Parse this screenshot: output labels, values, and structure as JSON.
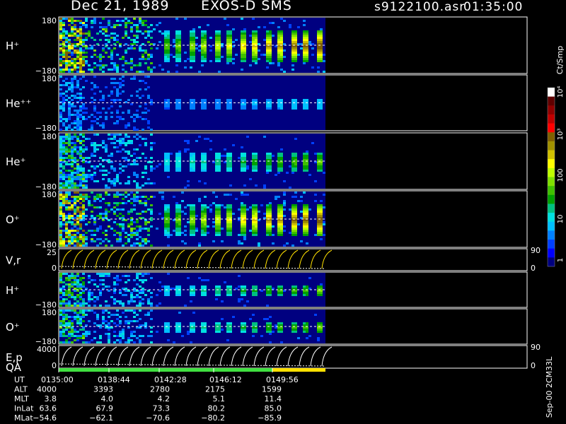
{
  "header": {
    "date": "Dec 21, 1989",
    "instrument": "EXOS-D SMS",
    "file": "s9122100.asr",
    "time": "01:35:00"
  },
  "colorbar": {
    "unit_label": "Ct/Smp",
    "tick_labels": [
      "1",
      "10",
      "100",
      "10³",
      "10⁴"
    ],
    "colors": [
      "#000080",
      "#0000ff",
      "#0040ff",
      "#0080ff",
      "#00c0ff",
      "#00e0e0",
      "#00c080",
      "#00a000",
      "#40c000",
      "#80e000",
      "#c0ff00",
      "#ffff00",
      "#d0c000",
      "#a09000",
      "#806000",
      "#ff0000",
      "#c00000",
      "#900000",
      "#600000",
      "#ffffff"
    ]
  },
  "side_note": "Sep-00 2CM33L",
  "panels": [
    {
      "label": "H⁺",
      "top": "180",
      "bottom": "−180",
      "kind": "spectrogram",
      "intensity": "strong"
    },
    {
      "label": "He⁺⁺",
      "top": "180",
      "bottom": "−180",
      "kind": "spectrogram",
      "intensity": "weak"
    },
    {
      "label": "He⁺",
      "top": "180",
      "bottom": "−180",
      "kind": "spectrogram",
      "intensity": "medium"
    },
    {
      "label": "O⁺",
      "top": "180",
      "bottom": "−180",
      "kind": "spectrogram",
      "intensity": "strong"
    },
    {
      "label": "V,r",
      "top": "25",
      "bottom": "0",
      "right_top": "90",
      "right_bottom": "0",
      "kind": "line"
    },
    {
      "label": "H⁺",
      "top": "",
      "bottom": "−180",
      "kind": "spectrogram",
      "intensity": "medium"
    },
    {
      "label": "O⁺",
      "top": "180",
      "bottom": "−180",
      "kind": "spectrogram",
      "intensity": "medium"
    },
    {
      "label": "E,p",
      "sublabel": "QA",
      "top": "4000",
      "bottom": "0",
      "right_top": "90",
      "right_bottom": "0",
      "kind": "line"
    }
  ],
  "qa_bar": [
    {
      "from": 0.0,
      "to": 0.8,
      "color": "#40e040"
    },
    {
      "from": 0.8,
      "to": 1.0,
      "color": "#ffe000"
    }
  ],
  "chart_data": {
    "type": "heatmap",
    "title": "Dec 21, 1989   EXOS-D SMS",
    "x": {
      "label": "UT",
      "ticks": [
        "0135:00",
        "0138:44",
        "0142:28",
        "0146:12",
        "0149:56"
      ]
    },
    "ephemeris": [
      {
        "name": "UT",
        "values": [
          "0135:00",
          "0138:44",
          "0142:28",
          "0146:12",
          "0149:56"
        ]
      },
      {
        "name": "ALT",
        "values": [
          "4000",
          "3393",
          "2780",
          "2175",
          "1599"
        ]
      },
      {
        "name": "MLT",
        "values": [
          "3.8",
          "4.0",
          "4.2",
          "5.1",
          "11.4"
        ]
      },
      {
        "name": "InLat",
        "values": [
          "63.6",
          "67.9",
          "73.3",
          "80.2",
          "85.0"
        ]
      },
      {
        "name": "MLat",
        "values": [
          "−54.6",
          "−62.1",
          "−70.6",
          "−80.2",
          "−85.9"
        ]
      }
    ]
  }
}
